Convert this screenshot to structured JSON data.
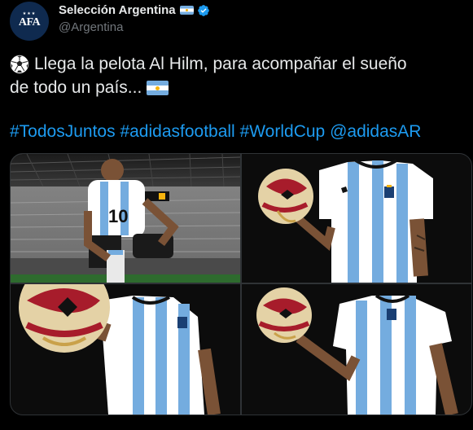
{
  "author": {
    "display_name": "Selección Argentina",
    "handle": "@Argentina",
    "avatar_initials": "AFA",
    "avatar_stars": "★★★",
    "verified": true
  },
  "tweet": {
    "line1": "Llega la pelota Al Hilm, para acompañar el sueño",
    "line2": "de todo un país...",
    "hashtags": [
      "#TodosJuntos",
      "#adidasfootball",
      "#WorldCup",
      "@adidasAR"
    ]
  },
  "media": {
    "count": 4,
    "photos": [
      {
        "name": "photo-player-stadium",
        "kit_number": "10"
      },
      {
        "name": "photo-ball-hand-jersey"
      },
      {
        "name": "photo-ball-closeup-jersey"
      },
      {
        "name": "photo-ball-hand-jersey-2"
      }
    ]
  },
  "colors": {
    "background": "#000000",
    "text": "#e7e9ea",
    "secondary": "#71767b",
    "link": "#1d9bf0",
    "verified": "#1d9bf0",
    "argentina_blue": "#74acdf"
  },
  "icons": {
    "verified": "verified-badge-icon",
    "ball": "soccer-ball-icon",
    "flag": "argentina-flag-icon"
  }
}
